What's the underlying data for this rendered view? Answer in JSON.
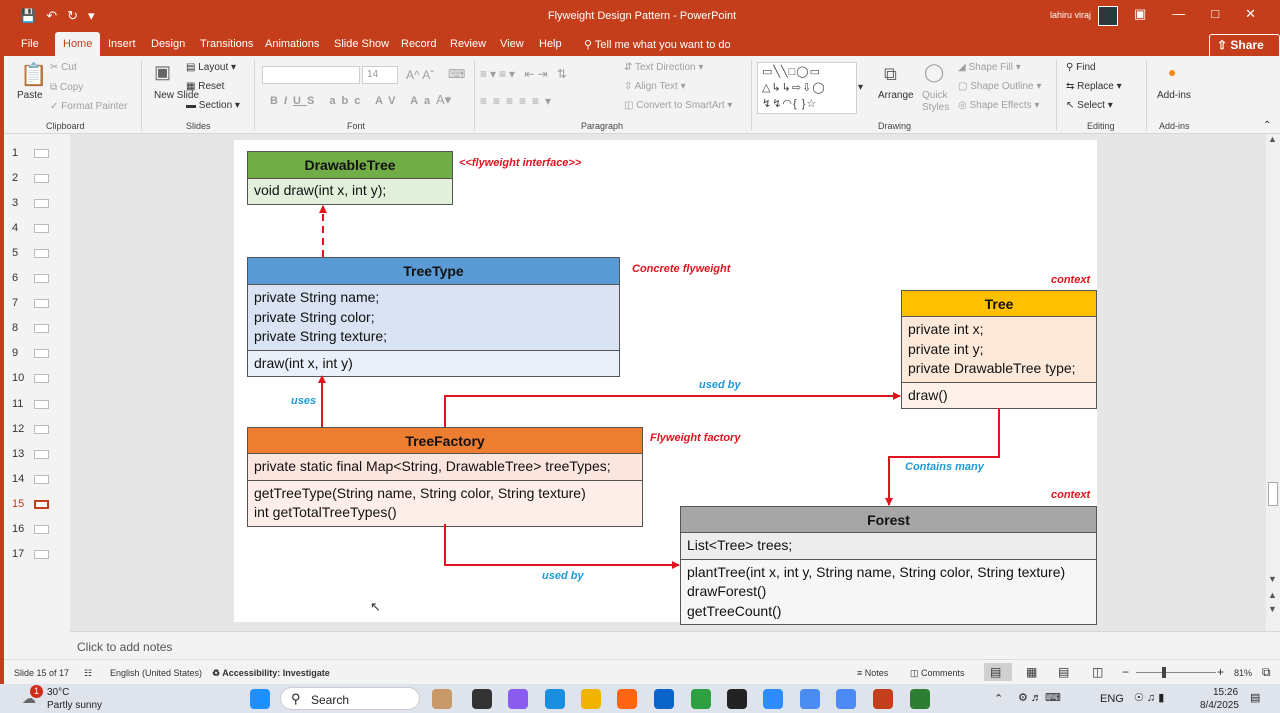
{
  "titlebar": {
    "title": "Flyweight Design Pattern  -  PowerPoint",
    "user": "lahiru viraj",
    "qat_icons": [
      "save-icon",
      "undo-icon",
      "redo-icon",
      "customize-icon"
    ]
  },
  "tabs": [
    "File",
    "Home",
    "Insert",
    "Design",
    "Transitions",
    "Animations",
    "Slide Show",
    "Record",
    "Review",
    "View",
    "Help"
  ],
  "active_tab": "Home",
  "tell_me": "Tell me what you want to do",
  "share": "Share",
  "ribbon": {
    "clipboard": {
      "paste": "Paste",
      "cut": "Cut",
      "copy": "Copy",
      "format_painter": "Format Painter",
      "label": "Clipboard"
    },
    "slides": {
      "new_slide": "New Slide",
      "layout": "Layout",
      "reset": "Reset",
      "section": "Section",
      "label": "Slides"
    },
    "font": {
      "size": "14",
      "label": "Font"
    },
    "paragraph": {
      "text_direction": "Text Direction",
      "align_text": "Align Text",
      "smartart": "Convert to SmartArt",
      "label": "Paragraph"
    },
    "drawing": {
      "arrange": "Arrange",
      "quick_styles": "Quick Styles",
      "shape_fill": "Shape Fill",
      "shape_outline": "Shape Outline",
      "shape_effects": "Shape Effects",
      "label": "Drawing"
    },
    "editing": {
      "find": "Find",
      "replace": "Replace",
      "select": "Select",
      "label": "Editing"
    },
    "addins": {
      "addins": "Add-ins",
      "label": "Add-ins"
    }
  },
  "slides_panel": [
    "1",
    "2",
    "3",
    "4",
    "5",
    "6",
    "7",
    "8",
    "9",
    "10",
    "11",
    "12",
    "13",
    "14",
    "15",
    "16",
    "17"
  ],
  "active_slide": "15",
  "diagram": {
    "drawable_tree": {
      "title": "DrawableTree",
      "method": "void draw(int x, int y);",
      "note": "<<flyweight interface>>"
    },
    "tree_type": {
      "title": "TreeType",
      "fields": [
        "private String name;",
        "private String color;",
        "private String texture;"
      ],
      "method": "draw(int x, int y)",
      "note": "Concrete flyweight"
    },
    "tree": {
      "title": "Tree",
      "fields": [
        "private int x;",
        "private int y;",
        "private DrawableTree type;"
      ],
      "method": "draw()",
      "note": "context"
    },
    "tree_factory": {
      "title": "TreeFactory",
      "field": "private static final Map<String, DrawableTree> treeTypes;",
      "methods": [
        "getTreeType(String name, String color, String texture)",
        "int getTotalTreeTypes()"
      ],
      "note": "Flyweight factory"
    },
    "forest": {
      "title": "Forest",
      "field": "List<Tree> trees;",
      "methods": [
        "plantTree(int x, int y, String name, String color, String texture)",
        "drawForest()",
        "getTreeCount()"
      ],
      "note": "context"
    },
    "edges": {
      "uses": "uses",
      "used_by_top": "used by",
      "contains_many": "Contains many",
      "used_by_bottom": "used by"
    },
    "colors": {
      "drawable_head": "#70ad47",
      "drawable_body": "#e2efda",
      "treetype_head": "#5b9bd5",
      "treetype_body": "#dae3f3",
      "tree_head": "#ffc000",
      "tree_body": "#fde9d9",
      "factory_head": "#ed7d31",
      "factory_body": "#fbe5df",
      "forest_head": "#a6a6a6",
      "forest_body": "#ededed",
      "arrow": "#e0141e"
    }
  },
  "notes_placeholder": "Click to add notes",
  "status": {
    "slide": "Slide 15 of 17",
    "language": "English (United States)",
    "accessibility": "Accessibility: Investigate",
    "notes": "Notes",
    "comments": "Comments",
    "zoom": "81%"
  },
  "taskbar": {
    "weather_temp": "30°C",
    "weather_desc": "Partly sunny",
    "weather_badge": "1",
    "search": "Search",
    "lang": "ENG",
    "time": "15:26",
    "date": "8/4/2025"
  }
}
